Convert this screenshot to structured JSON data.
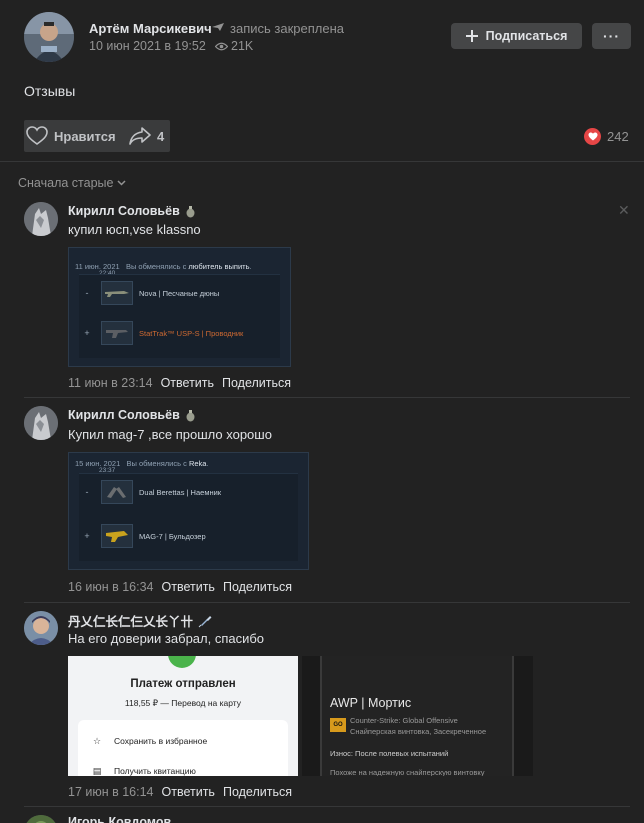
{
  "post": {
    "author": "Артём Марсикевич",
    "pinned": "запись закреплена",
    "date": "10 июн 2021 в 19:52",
    "views": "21K",
    "subscribe_label": "Подписаться",
    "more_label": "···",
    "text": "Отзывы",
    "like_label": "Нравится",
    "share_count": "4",
    "reactions_count": "242"
  },
  "comments_sort": "Сначала старые",
  "comments": [
    {
      "author": "Кирилл Соловьёв",
      "text": "купил юсп,vse klassno",
      "date": "11 июн в 23:14",
      "reply": "Ответить",
      "share": "Поделиться",
      "trade": {
        "date": "11 июн. 2021",
        "time": "22:40",
        "message": "Вы обменялись с",
        "partner": "любитель выпить",
        "give_item": "Nova | Песчаные дюны",
        "get_item": "StatTrak™ USP-S | Проводник",
        "minus": "-",
        "plus": "+"
      }
    },
    {
      "author": "Кирилл Соловьёв",
      "text": "Купил mag-7 ,все прошло хорошо",
      "date": "16 июн в 16:34",
      "reply": "Ответить",
      "share": "Поделиться",
      "trade": {
        "date": "15 июн. 2021",
        "time": "23:37",
        "message": "Вы обменялись с",
        "partner": "Reka",
        "give_item": "Dual Berettas | Наемник",
        "get_item": "MAG-7 | Бульдозер",
        "minus": "-",
        "plus": "+"
      }
    },
    {
      "author": "丹乂仁长仁仨乂长丫卄",
      "text": "На его доверии забрал, спасибо",
      "date": "17 июн в 16:14",
      "reply": "Ответить",
      "share": "Поделиться",
      "payment": {
        "title": "Платеж отправлен",
        "subtitle": "118,55 ₽ — Перевод на карту",
        "row1": "Сохранить в избранное",
        "row2": "Получить квитанцию"
      },
      "awp": {
        "title": "AWP | Мортис",
        "game": "Counter-Strike: Global Offensive",
        "type": "Снайперская винтовка, Засекреченное",
        "wear": "Износ: После полевых испытаний",
        "cut": "Похоже на надежную снайперскую винтовку"
      }
    }
  ],
  "next_comment_author": "Игорь Ковдомов"
}
